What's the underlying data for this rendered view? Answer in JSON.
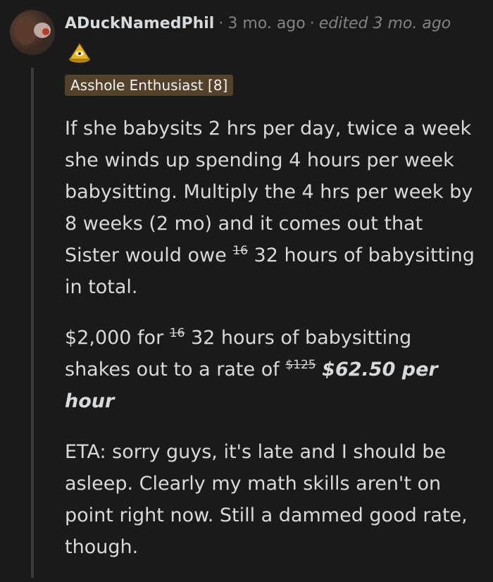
{
  "comment": {
    "username": "ADuckNamedPhil",
    "age": "3 mo. ago",
    "edited": "edited 3 mo. ago",
    "flair": "Asshole Enthusiast [8]",
    "award_icon": "pyramid-eye-award-icon",
    "paragraphs": {
      "p1_a": "If she babysits 2 hrs per day, twice a week she winds up spending 4 hours per week babysitting. Multiply the 4 hrs per week by 8 weeks (2 mo) and it comes out that Sister would owe ",
      "p1_strike": "16",
      "p1_b": " 32 hours of babysitting in total.",
      "p2_a": "$2,000 for ",
      "p2_strike1": "16",
      "p2_b": " 32 hours of babysitting shakes out to a rate of ",
      "p2_strike2": "$125",
      "p2_c": " ",
      "p2_emph": "$62.50 per hour",
      "p3": "ETA: sorry guys, it's late and I should be asleep. Clearly my math skills aren't on point right now. Still a dammed good rate, though."
    }
  },
  "colors": {
    "background": "#1a1a1b",
    "text": "#d7dadc",
    "meta": "#818384",
    "flair_bg": "#54412b"
  }
}
